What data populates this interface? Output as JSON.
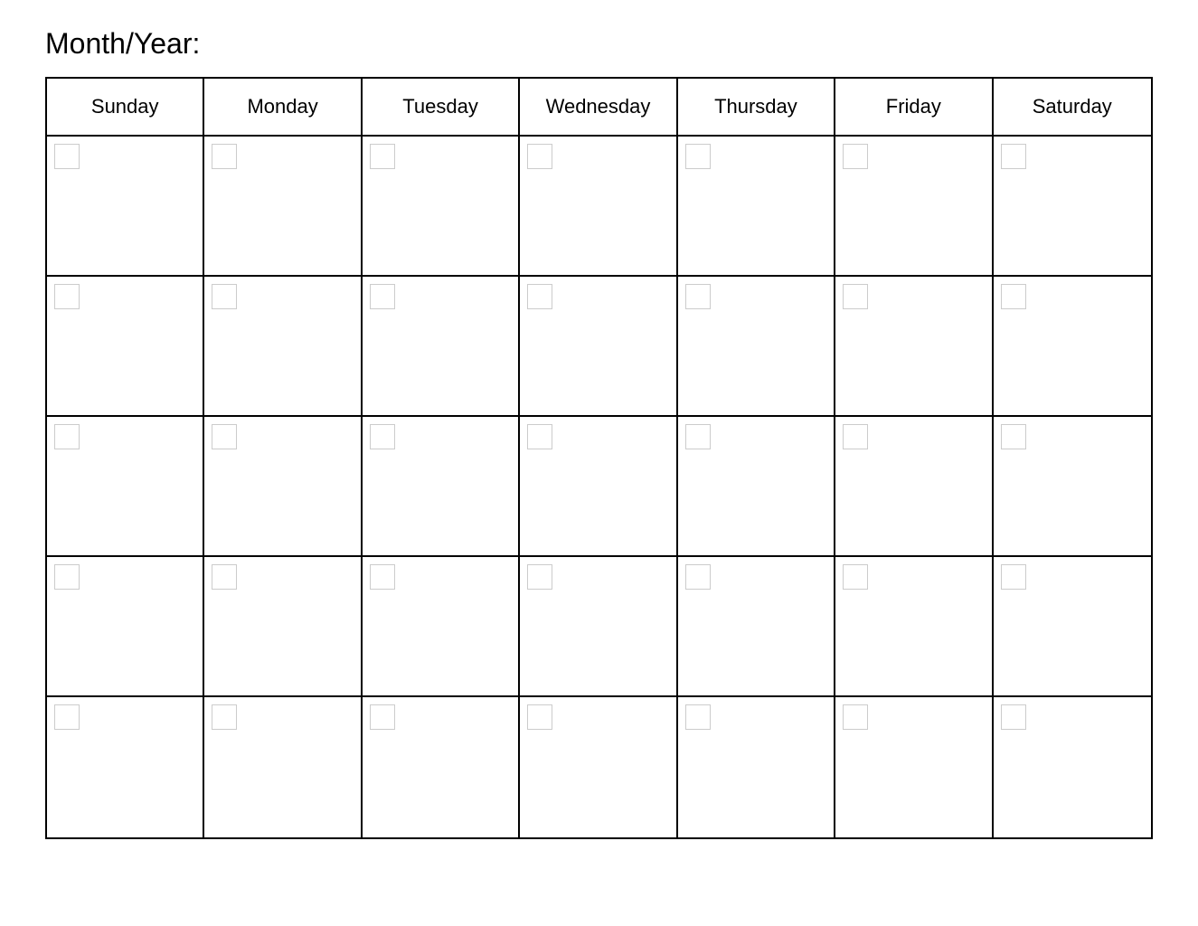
{
  "header": {
    "month_year_label": "Month/Year:"
  },
  "calendar": {
    "days": [
      "Sunday",
      "Monday",
      "Tuesday",
      "Wednesday",
      "Thursday",
      "Friday",
      "Saturday"
    ],
    "rows": 5
  }
}
